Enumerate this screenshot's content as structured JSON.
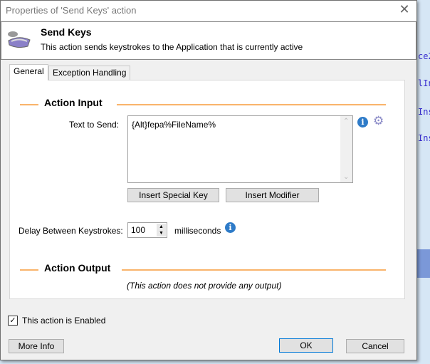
{
  "background": {
    "snippets": [
      "ce2",
      "lIn",
      "Ins",
      "Ins"
    ]
  },
  "dialog": {
    "title": "Properties of 'Send Keys' action",
    "header": {
      "title": "Send Keys",
      "description": "This action sends keystrokes to the Application that is currently active",
      "icon": "keyboard-icon"
    },
    "tabs": [
      {
        "label": "General",
        "active": true
      },
      {
        "label": "Exception Handling",
        "active": false
      }
    ],
    "input_section": "Action Input",
    "text_to_send": {
      "label": "Text to Send:",
      "value": "{Alt}fepa%FileName%"
    },
    "insert_special_key": "Insert Special Key",
    "insert_modifier": "Insert Modifier",
    "delay": {
      "label": "Delay Between Keystrokes:",
      "value": "100",
      "unit": "milliseconds"
    },
    "output_section": "Action Output",
    "output_note": "(This action does not provide any output)",
    "enabled": {
      "label": "This action is Enabled",
      "checked": true
    },
    "buttons": {
      "more_info": "More Info",
      "ok": "OK",
      "cancel": "Cancel"
    },
    "colors": {
      "section_line": "#f9b46b",
      "accent_blue": "#0078d7"
    }
  }
}
